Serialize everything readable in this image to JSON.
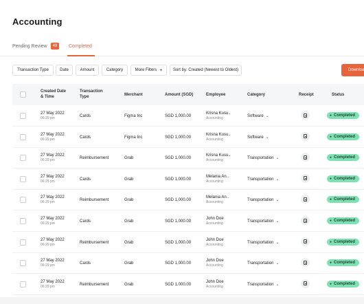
{
  "page": {
    "title": "Accounting"
  },
  "tabs": [
    {
      "label": "Pending Review",
      "badge": "49"
    },
    {
      "label": "Completed"
    }
  ],
  "filters": [
    "Transaction Type",
    "Date",
    "Amount",
    "Category",
    "More Filters",
    "Sort by: Created (Newest to Oldest)"
  ],
  "filter_more_icon": "+",
  "download_label": "Download",
  "table": {
    "headers": {
      "created": "Created Date",
      "created2": "& Time",
      "type": "Transaction",
      "type2": "Type",
      "merchant": "Merchant",
      "amount": "Amount (SGD)",
      "employee": "Employee",
      "category": "Category",
      "receipt": "Receipt",
      "status": "Status"
    },
    "rows": [
      {
        "date": "27 May 2022",
        "time": "06:29 pm",
        "type": "Cards",
        "merchant": "Figma Inc",
        "amount": "SGD 1,000.00",
        "employee": "Krisna Kusu..",
        "dept": "Accounting",
        "category": "Software",
        "status": "Completed"
      },
      {
        "date": "27 May 2022",
        "time": "06:29 pm",
        "type": "Cards",
        "merchant": "Figma Inc",
        "amount": "SGD 1,000.00",
        "employee": "Krisna Kusu..",
        "dept": "Accounting",
        "category": "Software",
        "status": "Completed"
      },
      {
        "date": "27 May 2022",
        "time": "06:29 pm",
        "type": "Reimbursement",
        "merchant": "Grab",
        "amount": "SGD 1,000.00",
        "employee": "Krisna Kusu..",
        "dept": "Accounting",
        "category": "Transportation",
        "status": "Completed"
      },
      {
        "date": "27 May 2022",
        "time": "06:29 pm",
        "type": "Cards",
        "merchant": "Grab",
        "amount": "SGD 1,000.00",
        "employee": "Melania An..",
        "dept": "Accounting",
        "category": "Transportation",
        "status": "Completed"
      },
      {
        "date": "27 May 2022",
        "time": "06:29 pm",
        "type": "Reimbursement",
        "merchant": "Grab",
        "amount": "SGD 1,000.00",
        "employee": "Melania An..",
        "dept": "Accounting",
        "category": "Transportation",
        "status": "Completed"
      },
      {
        "date": "27 May 2022",
        "time": "06:29 pm",
        "type": "Cards",
        "merchant": "Grab",
        "amount": "SGD 1,000.00",
        "employee": "John Doe",
        "dept": "Accounting",
        "category": "Transportation",
        "status": "Completed"
      },
      {
        "date": "27 May 2022",
        "time": "06:29 pm",
        "type": "Reimbursement",
        "merchant": "Grab",
        "amount": "SGD 1,000.00",
        "employee": "John Doe",
        "dept": "Accounting",
        "category": "Transportation",
        "status": "Completed"
      },
      {
        "date": "27 May 2022",
        "time": "06:29 pm",
        "type": "Cards",
        "merchant": "Grab",
        "amount": "SGD 1,000.00",
        "employee": "John Doe",
        "dept": "Accounting",
        "category": "Transportation",
        "status": "Completed"
      },
      {
        "date": "27 May 2022",
        "time": "06:29 pm",
        "type": "Reimbursement",
        "merchant": "Grab",
        "amount": "SGD 1,000.00",
        "employee": "John Doe",
        "dept": "Accounting",
        "category": "Transportation",
        "status": "Completed"
      }
    ]
  },
  "icons": {
    "chevron": "chevron-down-icon",
    "receipt": "receipt-icon",
    "status_dot": "check-dot-icon",
    "more_filters": "plus-icon"
  },
  "colors": {
    "accent": "#e8643a",
    "status_bg": "#7fe0b2",
    "status_text": "#1b4a36"
  }
}
